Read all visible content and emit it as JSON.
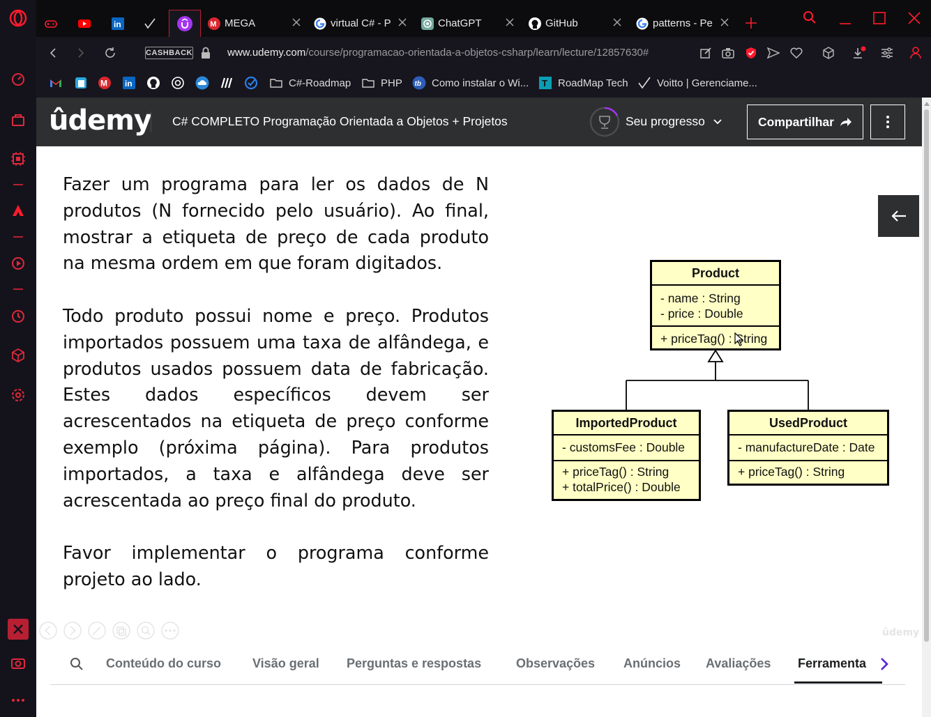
{
  "browser": {
    "tabs": [
      {
        "title": "",
        "icon": "gamepad-icon"
      },
      {
        "title": "",
        "icon": "youtube-icon"
      },
      {
        "title": "",
        "icon": "linkedin-icon"
      },
      {
        "title": "",
        "icon": "checkmark-icon"
      },
      {
        "title": "",
        "icon": "udemy-icon",
        "active": true
      },
      {
        "title": "MEGA",
        "icon": "mega-icon"
      },
      {
        "title": "virtual C# - P",
        "icon": "google-icon"
      },
      {
        "title": "ChatGPT",
        "icon": "chatgpt-icon"
      },
      {
        "title": "GitHub",
        "icon": "github-icon"
      },
      {
        "title": "patterns - Pe",
        "icon": "google-icon"
      }
    ],
    "cashback_label": "CASHBACK",
    "url_domain": "www.udemy.com",
    "url_path": "/course/programacao-orientada-a-objetos-csharp/learn/lecture/12857630#",
    "bookmarks": [
      {
        "label": "",
        "icon": "gmail-icon"
      },
      {
        "label": "",
        "icon": "notes-icon"
      },
      {
        "label": "",
        "icon": "mega-icon"
      },
      {
        "label": "",
        "icon": "linkedin-icon"
      },
      {
        "label": "",
        "icon": "github-icon"
      },
      {
        "label": "",
        "icon": "chatgpt-icon"
      },
      {
        "label": "",
        "icon": "cloud-icon"
      },
      {
        "label": "",
        "icon": "slash-icon"
      },
      {
        "label": "",
        "icon": "check-circle-icon"
      },
      {
        "label": "C#-Roadmap",
        "icon": "folder-icon"
      },
      {
        "label": "PHP",
        "icon": "folder-icon"
      },
      {
        "label": "Como instalar o Wi...",
        "icon": "tb-icon"
      },
      {
        "label": "RoadMap Tech",
        "icon": "t-icon"
      },
      {
        "label": "Voitto | Gerenciame...",
        "icon": "checkmark-icon"
      }
    ]
  },
  "udemy": {
    "logo": "ûdemy",
    "course_title": "C# COMPLETO Programação Orientada a Objetos + Projetos",
    "progress_label": "Seu progresso",
    "share_label": "Compartilhar",
    "watermark": "ûdemy"
  },
  "slide": {
    "paragraphs": [
      "Fazer um programa para ler os dados de N produtos (N fornecido pelo usuário). Ao final, mostrar a etiqueta de preço de cada produto na mesma ordem em que foram digitados.",
      "Todo produto possui nome e preço. Produtos importados possuem uma taxa de alfândega, e produtos usados possuem data de fabricação. Estes dados específicos devem ser acrescentados na etiqueta de preço conforme exemplo (próxima página). Para produtos importados, a taxa e alfândega deve ser acrescentada ao preço final do produto.",
      "Favor implementar o programa conforme projeto ao lado."
    ],
    "uml": {
      "product": {
        "name": "Product",
        "attrs": [
          "- name : String",
          "- price : Double"
        ],
        "methods": [
          "+ priceTag() : String"
        ]
      },
      "imported": {
        "name": "ImportedProduct",
        "attrs": [
          "- customsFee : Double"
        ],
        "methods": [
          "+ priceTag() : String",
          "+ totalPrice() : Double"
        ]
      },
      "used": {
        "name": "UsedProduct",
        "attrs": [
          "- manufactureDate : Date"
        ],
        "methods": [
          "+ priceTag() : String"
        ]
      }
    }
  },
  "course_tabs": [
    "Conteúdo do curso",
    "Visão geral",
    "Perguntas e respostas",
    "Observações",
    "Anúncios",
    "Avaliações",
    "Ferramenta"
  ],
  "colors": {
    "opera_red": "#ff1b2d",
    "udemy_header": "#2d2f31",
    "uml_fill": "#ffffc6",
    "udemy_purple": "#a435f0"
  }
}
